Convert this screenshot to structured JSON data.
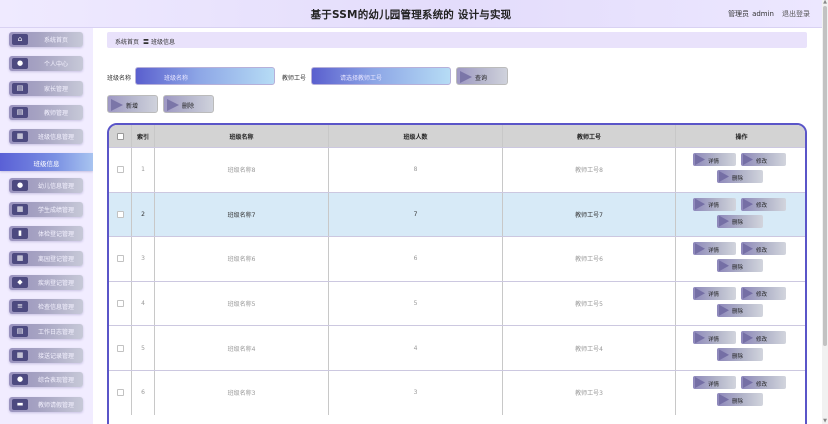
{
  "header": {
    "title": "基于SSM的幼儿园管理系统的 设计与实现",
    "user_role": "管理员",
    "user_name": "admin",
    "logout": "退出登录"
  },
  "sidebar": {
    "items": [
      {
        "label": "系统首页",
        "icon": "home-icon"
      },
      {
        "label": "个人中心",
        "icon": "user-icon"
      },
      {
        "label": "家长管理",
        "icon": "doc-icon"
      },
      {
        "label": "教师管理",
        "icon": "doc-icon"
      },
      {
        "label": "班级信息管理",
        "icon": "grid-icon"
      },
      {
        "label": "班级信息",
        "icon": "",
        "active": true
      },
      {
        "label": "幼儿信息管理",
        "icon": "user-icon"
      },
      {
        "label": "学生成绩管理",
        "icon": "grid-icon"
      },
      {
        "label": "体检登记管理",
        "icon": "chart-icon"
      },
      {
        "label": "离园登记管理",
        "icon": "grid-icon"
      },
      {
        "label": "疾病登记管理",
        "icon": "pin-icon"
      },
      {
        "label": "检查信息管理",
        "icon": "list-icon"
      },
      {
        "label": "工作日志管理",
        "icon": "doc-icon"
      },
      {
        "label": "接送记录管理",
        "icon": "grid-icon"
      },
      {
        "label": "综合表现管理",
        "icon": "user-icon"
      },
      {
        "label": "教师请假管理",
        "icon": "folder-icon"
      }
    ]
  },
  "breadcrumb": {
    "home": "系统首页",
    "sep": "〓",
    "current": "班级信息"
  },
  "search": {
    "class_label": "班级名称",
    "class_placeholder": "班级名称",
    "teacher_label": "教师工号",
    "teacher_placeholder": "请选择教师工号",
    "query_button": "查询"
  },
  "toolbar": {
    "add_button": "新增",
    "delete_button": "删除"
  },
  "table": {
    "headers": [
      "索引",
      "班级名称",
      "班级人数",
      "教师工号",
      "操作"
    ],
    "rows": [
      {
        "index": "1",
        "name": "班级名称8",
        "count": "8",
        "teacher": "教师工号8"
      },
      {
        "index": "2",
        "name": "班级名称7",
        "count": "7",
        "teacher": "教师工号7",
        "highlight": true
      },
      {
        "index": "3",
        "name": "班级名称6",
        "count": "6",
        "teacher": "教师工号6"
      },
      {
        "index": "4",
        "name": "班级名称5",
        "count": "5",
        "teacher": "教师工号5"
      },
      {
        "index": "5",
        "name": "班级名称4",
        "count": "4",
        "teacher": "教师工号4"
      },
      {
        "index": "6",
        "name": "班级名称3",
        "count": "3",
        "teacher": "教师工号3"
      }
    ],
    "actions": {
      "detail": "详情",
      "edit": "修改",
      "delete": "删除"
    }
  },
  "colors": {
    "accent": "#5a55c8",
    "highlight_row": "#d7eaf7",
    "sidebar_bg": "#f1ecff"
  }
}
